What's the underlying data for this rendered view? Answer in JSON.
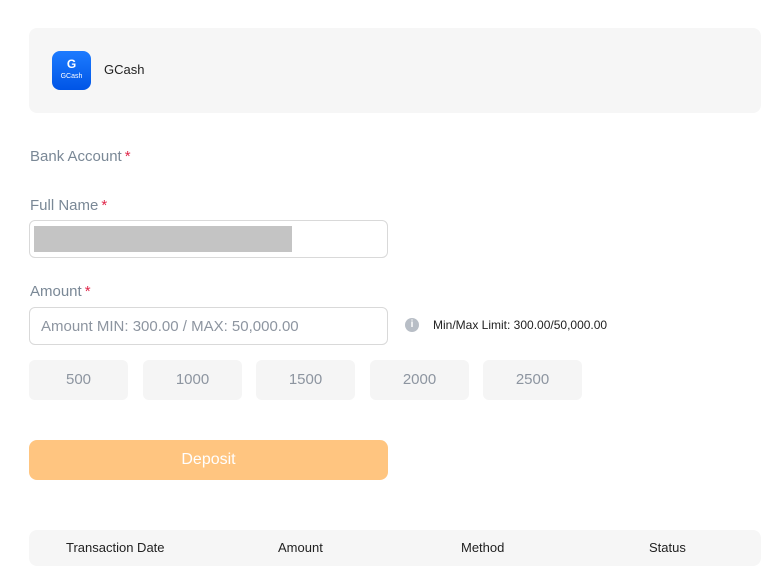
{
  "payment_method": {
    "logo_text": "G",
    "logo_subtext": "GCash",
    "name": "GCash"
  },
  "bank_account": {
    "label": "Bank Account",
    "required_mark": "*"
  },
  "full_name": {
    "label": "Full Name",
    "required_mark": "*"
  },
  "amount": {
    "label": "Amount",
    "required_mark": "*",
    "placeholder": "Amount MIN: 300.00 / MAX: 50,000.00",
    "limit_text": "Min/Max Limit: 300.00/50,000.00",
    "quick_amounts": [
      "500",
      "1000",
      "1500",
      "2000",
      "2500"
    ]
  },
  "deposit": {
    "label": "Deposit"
  },
  "table": {
    "headers": [
      "Transaction Date",
      "Amount",
      "Method",
      "Status"
    ]
  },
  "colors": {
    "required": "#e0274a",
    "deposit_button": "#ffc580",
    "gcash_blue": "#0055e6"
  }
}
